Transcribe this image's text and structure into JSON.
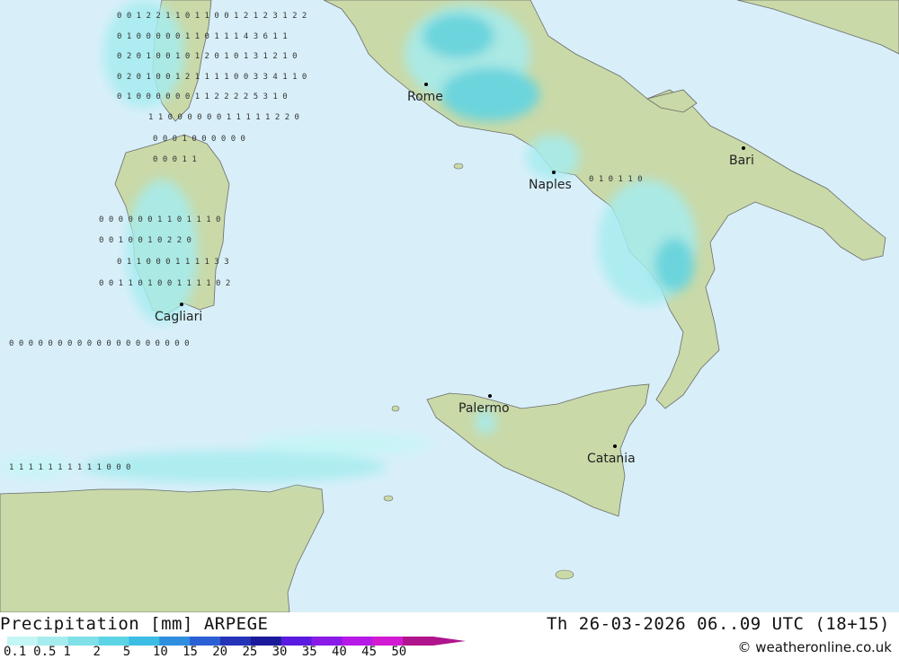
{
  "map": {
    "colors": {
      "sea": "#d8eff9",
      "land": "#c9d9a8",
      "land_light": "#e3dcc0",
      "precip_light": "#a6ecef",
      "precip_mid": "#5cd4e6",
      "precip_heavy": "#34b2e0"
    },
    "cities": [
      {
        "name": "Rome",
        "label": "Rome"
      },
      {
        "name": "Naples",
        "label": "Naples"
      },
      {
        "name": "Bari",
        "label": "Bari"
      },
      {
        "name": "Cagliari",
        "label": "Cagliari"
      },
      {
        "name": "Palermo",
        "label": "Palermo"
      },
      {
        "name": "Catania",
        "label": "Catania"
      }
    ]
  },
  "legend": {
    "title": "Precipitation [mm] ARPEGE",
    "valid_time": "Th 26-03-2026 06..09 UTC (18+15)",
    "credit": "© weatheronline.co.uk",
    "scale": [
      {
        "label": "0.1",
        "color": "#c4f6f6"
      },
      {
        "label": "0.5",
        "color": "#a6ecef"
      },
      {
        "label": "1",
        "color": "#7fe0e8"
      },
      {
        "label": "2",
        "color": "#5cd4e6"
      },
      {
        "label": "5",
        "color": "#3cbde4"
      },
      {
        "label": "10",
        "color": "#2f8fdf"
      },
      {
        "label": "15",
        "color": "#2b5fd4"
      },
      {
        "label": "20",
        "color": "#2433b8"
      },
      {
        "label": "25",
        "color": "#1a1a9a"
      },
      {
        "label": "30",
        "color": "#5a1ae0"
      },
      {
        "label": "35",
        "color": "#8a1ae6"
      },
      {
        "label": "40",
        "color": "#b61ae6"
      },
      {
        "label": "45",
        "color": "#d21ad2"
      },
      {
        "label": "50",
        "color": "#b0148c"
      }
    ]
  },
  "grid_values": {
    "rows": [
      "0 0 1 2 2    1 1 0 1 1 0 0 1 2 1 2 3 1 2 2",
      "0 1 0 0      0 0 0 1 1 0 1 1 1 4 3 6 1 1",
      "0 2 0 1 0    0 1 0 1 2 0 1 0 1 3 1 2 1 0",
      "0 2 0 1 0    0 1 2 1 1 1 1 0 0 3 3 4 1 1 0",
      "0 1 0 0 0    0 0 0 1 1 2 2 2 2 5 3 1 0",
      "1 1          0 0 0 0 0 0 1 1 1 1 1 2 2 0",
      "0 0 0 1      0 0 0 0 0 0",
      "0 0 0        1 1",
      "0 1 0        1 1 0",
      "0 0 0 0 0    0 1 1 0 1 1 1 0",
      "0 0 1 0 0    1 0 2 2 0",
      "0 1 1 0 0    0 1 1 1 1 3 3",
      "0 0 1 1 0 1  0 0 1 1 1 1 0 2",
      "0 0 0 0 0 0 0 0 0 0 0 0 0 0 0 0 0 0 0",
      "1 1 1 1 1 1 1 1 1 1 0 0 0"
    ]
  }
}
